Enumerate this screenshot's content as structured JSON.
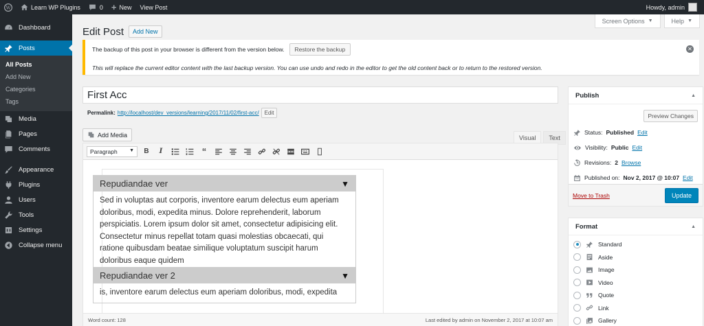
{
  "adminbar": {
    "site_name": "Learn WP Plugins",
    "comment_count": "0",
    "new_label": "New",
    "view_post": "View Post",
    "howdy": "Howdy, admin"
  },
  "sidebar": {
    "dashboard": "Dashboard",
    "posts": "Posts",
    "posts_sub": [
      "All Posts",
      "Add New",
      "Categories",
      "Tags"
    ],
    "media": "Media",
    "pages": "Pages",
    "comments": "Comments",
    "appearance": "Appearance",
    "plugins": "Plugins",
    "users": "Users",
    "tools": "Tools",
    "settings": "Settings",
    "collapse": "Collapse menu"
  },
  "screen_options": "Screen Options",
  "help": "Help",
  "page_title": "Edit Post",
  "add_new": "Add New",
  "notice": {
    "text": "The backup of this post in your browser is different from the version below.",
    "button": "Restore the backup",
    "detail": "This will replace the current editor content with the last backup version. You can use undo and redo in the editor to get the old content back or to return to the restored version."
  },
  "post_title": "First Acc",
  "permalink": {
    "label": "Permalink:",
    "url_base": "http://localhost/dev_versions/learning/2017/11/02/",
    "slug": "first-acc",
    "tail": "/",
    "edit": "Edit"
  },
  "add_media": "Add Media",
  "editor_tabs": {
    "visual": "Visual",
    "text": "Text"
  },
  "format_select": "Paragraph",
  "accordion": [
    {
      "title": "Repudiandae ver",
      "body": "Sed in voluptas aut corporis, inventore earum delectus eum aperiam doloribus, modi, expedita minus. Dolore reprehenderit, laborum perspiciatis. Lorem ipsum dolor sit amet, consectetur adipisicing elit. Consectetur minus repellat totam quasi molestias obcaecati, qui ratione quibusdam beatae similique voluptatum suscipit harum doloribus eaque quidem"
    },
    {
      "title": "Repudiandae ver 2",
      "body": "is, inventore earum delectus eum aperiam doloribus, modi, expedita"
    }
  ],
  "word_count": "Word count: 128",
  "last_edited": "Last edited by admin on November 2, 2017 at 10:07 am",
  "publish": {
    "title": "Publish",
    "preview": "Preview Changes",
    "status_label": "Status:",
    "status_value": "Published",
    "visibility_label": "Visibility:",
    "visibility_value": "Public",
    "revisions_label": "Revisions:",
    "revisions_value": "2",
    "browse": "Browse",
    "published_label": "Published on:",
    "published_value": "Nov 2, 2017 @ 10:07",
    "edit": "Edit",
    "trash": "Move to Trash",
    "update": "Update"
  },
  "format_box": {
    "title": "Format",
    "options": [
      "Standard",
      "Aside",
      "Image",
      "Video",
      "Quote",
      "Link",
      "Gallery"
    ],
    "selected": "Standard"
  }
}
